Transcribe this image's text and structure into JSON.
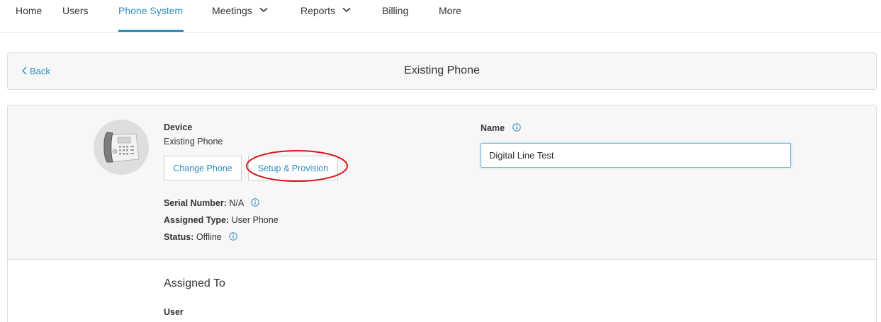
{
  "nav": {
    "items": [
      {
        "label": "Home",
        "active": false,
        "dropdown": false
      },
      {
        "label": "Users",
        "active": false,
        "dropdown": false
      },
      {
        "label": "Phone System",
        "active": true,
        "dropdown": false
      },
      {
        "label": "Meetings",
        "active": false,
        "dropdown": true
      },
      {
        "label": "Reports",
        "active": false,
        "dropdown": true
      },
      {
        "label": "Billing",
        "active": false,
        "dropdown": false
      },
      {
        "label": "More",
        "active": false,
        "dropdown": false
      }
    ]
  },
  "header": {
    "back_label": "Back",
    "title": "Existing Phone"
  },
  "device": {
    "label": "Device",
    "value": "Existing Phone",
    "image_icon": "desk-phone-icon",
    "change_button": "Change Phone",
    "setup_button": "Setup & Provision",
    "serial_label": "Serial Number:",
    "serial_value": "N/A",
    "assigned_type_label": "Assigned Type:",
    "assigned_type_value": "User Phone",
    "status_label": "Status:",
    "status_value": "Offline"
  },
  "name_field": {
    "label": "Name",
    "value": "Digital Line Test"
  },
  "assigned_to": {
    "title": "Assigned To",
    "user_label": "User"
  },
  "colors": {
    "accent": "#2d8cbd",
    "annotation": "#d9141a",
    "panel_bg": "#f7f7f7",
    "border": "#dcdcdc"
  }
}
